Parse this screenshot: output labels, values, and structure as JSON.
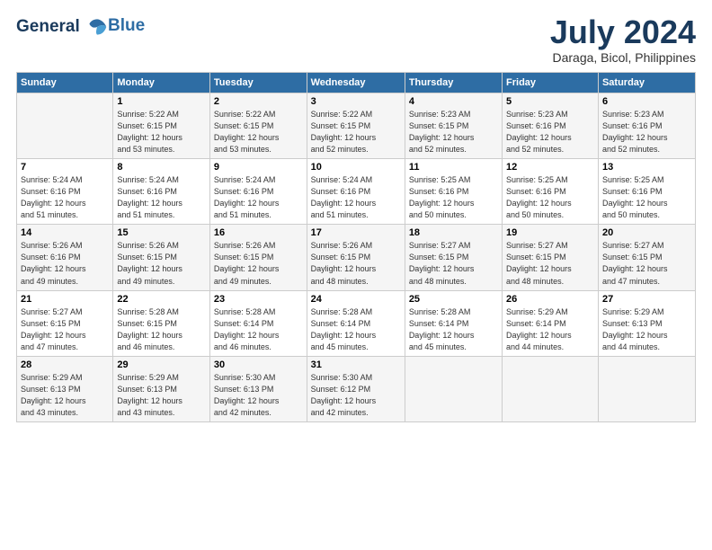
{
  "header": {
    "logo_line1": "General",
    "logo_line2": "Blue",
    "title": "July 2024",
    "subtitle": "Daraga, Bicol, Philippines"
  },
  "calendar": {
    "columns": [
      "Sunday",
      "Monday",
      "Tuesday",
      "Wednesday",
      "Thursday",
      "Friday",
      "Saturday"
    ],
    "weeks": [
      [
        {
          "day": "",
          "info": ""
        },
        {
          "day": "1",
          "info": "Sunrise: 5:22 AM\nSunset: 6:15 PM\nDaylight: 12 hours\nand 53 minutes."
        },
        {
          "day": "2",
          "info": "Sunrise: 5:22 AM\nSunset: 6:15 PM\nDaylight: 12 hours\nand 53 minutes."
        },
        {
          "day": "3",
          "info": "Sunrise: 5:22 AM\nSunset: 6:15 PM\nDaylight: 12 hours\nand 52 minutes."
        },
        {
          "day": "4",
          "info": "Sunrise: 5:23 AM\nSunset: 6:15 PM\nDaylight: 12 hours\nand 52 minutes."
        },
        {
          "day": "5",
          "info": "Sunrise: 5:23 AM\nSunset: 6:16 PM\nDaylight: 12 hours\nand 52 minutes."
        },
        {
          "day": "6",
          "info": "Sunrise: 5:23 AM\nSunset: 6:16 PM\nDaylight: 12 hours\nand 52 minutes."
        }
      ],
      [
        {
          "day": "7",
          "info": "Sunrise: 5:24 AM\nSunset: 6:16 PM\nDaylight: 12 hours\nand 51 minutes."
        },
        {
          "day": "8",
          "info": "Sunrise: 5:24 AM\nSunset: 6:16 PM\nDaylight: 12 hours\nand 51 minutes."
        },
        {
          "day": "9",
          "info": "Sunrise: 5:24 AM\nSunset: 6:16 PM\nDaylight: 12 hours\nand 51 minutes."
        },
        {
          "day": "10",
          "info": "Sunrise: 5:24 AM\nSunset: 6:16 PM\nDaylight: 12 hours\nand 51 minutes."
        },
        {
          "day": "11",
          "info": "Sunrise: 5:25 AM\nSunset: 6:16 PM\nDaylight: 12 hours\nand 50 minutes."
        },
        {
          "day": "12",
          "info": "Sunrise: 5:25 AM\nSunset: 6:16 PM\nDaylight: 12 hours\nand 50 minutes."
        },
        {
          "day": "13",
          "info": "Sunrise: 5:25 AM\nSunset: 6:16 PM\nDaylight: 12 hours\nand 50 minutes."
        }
      ],
      [
        {
          "day": "14",
          "info": "Sunrise: 5:26 AM\nSunset: 6:16 PM\nDaylight: 12 hours\nand 49 minutes."
        },
        {
          "day": "15",
          "info": "Sunrise: 5:26 AM\nSunset: 6:15 PM\nDaylight: 12 hours\nand 49 minutes."
        },
        {
          "day": "16",
          "info": "Sunrise: 5:26 AM\nSunset: 6:15 PM\nDaylight: 12 hours\nand 49 minutes."
        },
        {
          "day": "17",
          "info": "Sunrise: 5:26 AM\nSunset: 6:15 PM\nDaylight: 12 hours\nand 48 minutes."
        },
        {
          "day": "18",
          "info": "Sunrise: 5:27 AM\nSunset: 6:15 PM\nDaylight: 12 hours\nand 48 minutes."
        },
        {
          "day": "19",
          "info": "Sunrise: 5:27 AM\nSunset: 6:15 PM\nDaylight: 12 hours\nand 48 minutes."
        },
        {
          "day": "20",
          "info": "Sunrise: 5:27 AM\nSunset: 6:15 PM\nDaylight: 12 hours\nand 47 minutes."
        }
      ],
      [
        {
          "day": "21",
          "info": "Sunrise: 5:27 AM\nSunset: 6:15 PM\nDaylight: 12 hours\nand 47 minutes."
        },
        {
          "day": "22",
          "info": "Sunrise: 5:28 AM\nSunset: 6:15 PM\nDaylight: 12 hours\nand 46 minutes."
        },
        {
          "day": "23",
          "info": "Sunrise: 5:28 AM\nSunset: 6:14 PM\nDaylight: 12 hours\nand 46 minutes."
        },
        {
          "day": "24",
          "info": "Sunrise: 5:28 AM\nSunset: 6:14 PM\nDaylight: 12 hours\nand 45 minutes."
        },
        {
          "day": "25",
          "info": "Sunrise: 5:28 AM\nSunset: 6:14 PM\nDaylight: 12 hours\nand 45 minutes."
        },
        {
          "day": "26",
          "info": "Sunrise: 5:29 AM\nSunset: 6:14 PM\nDaylight: 12 hours\nand 44 minutes."
        },
        {
          "day": "27",
          "info": "Sunrise: 5:29 AM\nSunset: 6:13 PM\nDaylight: 12 hours\nand 44 minutes."
        }
      ],
      [
        {
          "day": "28",
          "info": "Sunrise: 5:29 AM\nSunset: 6:13 PM\nDaylight: 12 hours\nand 43 minutes."
        },
        {
          "day": "29",
          "info": "Sunrise: 5:29 AM\nSunset: 6:13 PM\nDaylight: 12 hours\nand 43 minutes."
        },
        {
          "day": "30",
          "info": "Sunrise: 5:30 AM\nSunset: 6:13 PM\nDaylight: 12 hours\nand 42 minutes."
        },
        {
          "day": "31",
          "info": "Sunrise: 5:30 AM\nSunset: 6:12 PM\nDaylight: 12 hours\nand 42 minutes."
        },
        {
          "day": "",
          "info": ""
        },
        {
          "day": "",
          "info": ""
        },
        {
          "day": "",
          "info": ""
        }
      ]
    ]
  }
}
